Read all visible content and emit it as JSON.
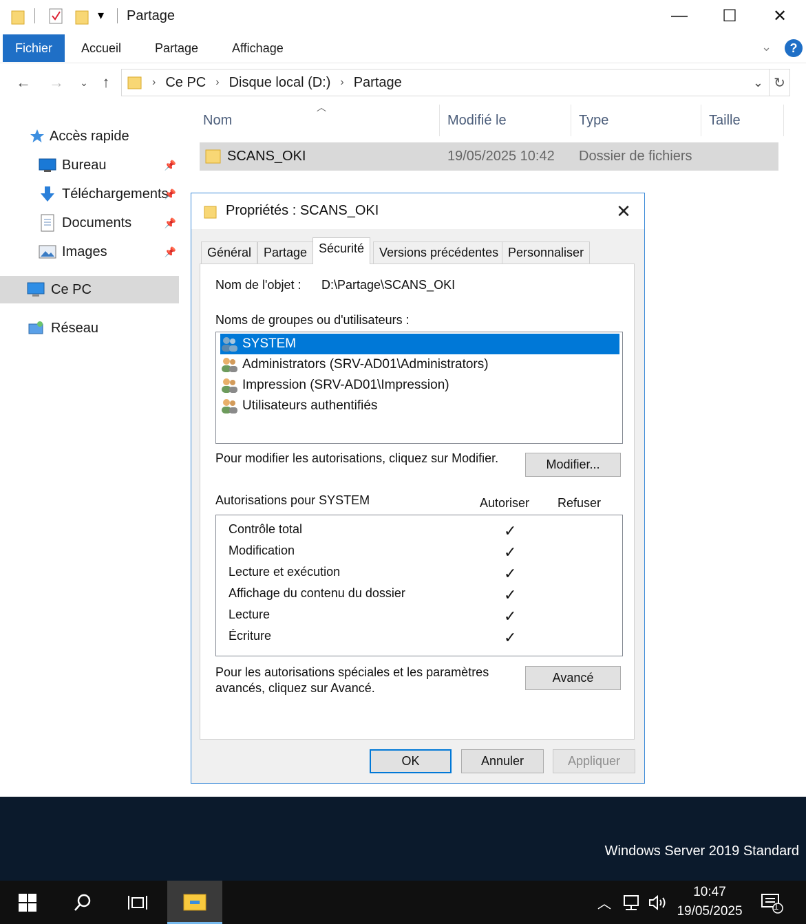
{
  "window": {
    "title": "Partage",
    "controls": {
      "minimize": "—",
      "maximize": "☐",
      "close": "✕"
    }
  },
  "ribbon": {
    "tabs": [
      {
        "label": "Fichier"
      },
      {
        "label": "Accueil"
      },
      {
        "label": "Partage"
      },
      {
        "label": "Affichage"
      }
    ],
    "help": "?"
  },
  "address": {
    "crumbs": [
      "Ce PC",
      "Disque local (D:)",
      "Partage"
    ],
    "refresh": "↻"
  },
  "nav_pane": {
    "quick_access": "Accès rapide",
    "items": [
      {
        "label": "Bureau",
        "icon": "desktop-icon"
      },
      {
        "label": "Téléchargements",
        "icon": "download-icon"
      },
      {
        "label": "Documents",
        "icon": "documents-icon"
      },
      {
        "label": "Images",
        "icon": "images-icon"
      }
    ],
    "this_pc": "Ce PC",
    "network": "Réseau"
  },
  "file_list": {
    "columns": [
      "Nom",
      "Modifié le",
      "Type",
      "Taille"
    ],
    "rows": [
      {
        "name": "SCANS_OKI",
        "modified": "19/05/2025 10:42",
        "type": "Dossier de fichiers",
        "size": ""
      }
    ]
  },
  "dialog": {
    "title": "Propriétés : SCANS_OKI",
    "tabs": [
      "Général",
      "Partage",
      "Sécurité",
      "Versions précédentes",
      "Personnaliser"
    ],
    "active_tab": "Sécurité",
    "object_label": "Nom de l'objet :",
    "object_value": "D:\\Partage\\SCANS_OKI",
    "groups_label": "Noms de groupes ou d'utilisateurs :",
    "users": [
      "SYSTEM",
      "Administrators (SRV-AD01\\Administrators)",
      "Impression (SRV-AD01\\Impression)",
      "Utilisateurs authentifiés"
    ],
    "modify_hint": "Pour modifier les autorisations, cliquez sur Modifier.",
    "modify_button": "Modifier...",
    "permissions_for": "Autorisations pour SYSTEM",
    "allow_header": "Autoriser",
    "deny_header": "Refuser",
    "permissions": [
      {
        "name": "Contrôle total",
        "allow": "✓",
        "deny": ""
      },
      {
        "name": "Modification",
        "allow": "✓",
        "deny": ""
      },
      {
        "name": "Lecture et exécution",
        "allow": "✓",
        "deny": ""
      },
      {
        "name": "Affichage du contenu du dossier",
        "allow": "✓",
        "deny": ""
      },
      {
        "name": "Lecture",
        "allow": "✓",
        "deny": ""
      },
      {
        "name": "Écriture",
        "allow": "✓",
        "deny": ""
      }
    ],
    "advanced_hint_1": "Pour les autorisations spéciales et les paramètres",
    "advanced_hint_2": "avancés, cliquez sur Avancé.",
    "advanced_button": "Avancé",
    "ok": "OK",
    "cancel": "Annuler",
    "apply": "Appliquer"
  },
  "desktop": {
    "edition": "Windows Server 2019 Standard"
  },
  "taskbar": {
    "time": "10:47",
    "date": "19/05/2025",
    "notifications": "1"
  }
}
